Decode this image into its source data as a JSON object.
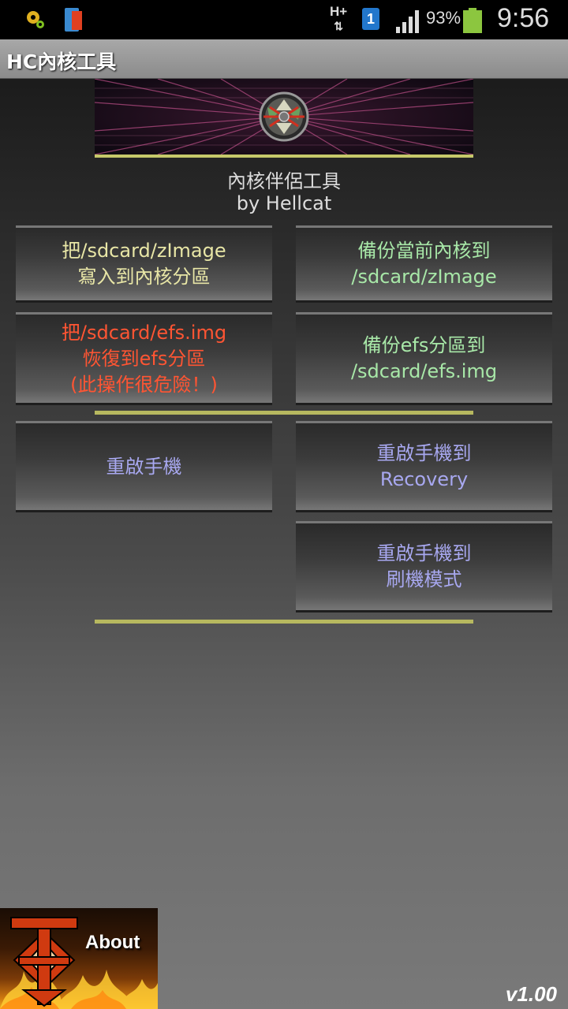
{
  "status_bar": {
    "network": "H+",
    "sim_slot": "1",
    "battery": "93%",
    "time": "9:56"
  },
  "app_title": "HC內核工具",
  "subtitle_line1": "內核伴侶工具",
  "subtitle_line2": "by Hellcat",
  "buttons": {
    "flash_zimage": {
      "line1": "把/sdcard/zImage",
      "line2": "寫入到內核分區",
      "color": "#e8e6a6"
    },
    "backup_kernel": {
      "line1": "備份當前內核到",
      "line2": "/sdcard/zImage",
      "color": "#a8e8a8"
    },
    "restore_efs": {
      "line1": "把/sdcard/efs.img",
      "line2": "恢復到efs分區",
      "line3": "(此操作很危險！)",
      "color": "#ff5533"
    },
    "backup_efs": {
      "line1": "備份efs分區到",
      "line2": "/sdcard/efs.img",
      "color": "#a8e8a8"
    },
    "reboot": {
      "line1": "重啟手機",
      "color": "#a8a8f0"
    },
    "reboot_recovery": {
      "line1": "重啟手機到",
      "line2": "Recovery",
      "color": "#a8a8f0"
    },
    "reboot_download": {
      "line1": "重啟手機到",
      "line2": "刷機模式",
      "color": "#a8a8f0"
    }
  },
  "about_label": "About",
  "version": "v1.00"
}
